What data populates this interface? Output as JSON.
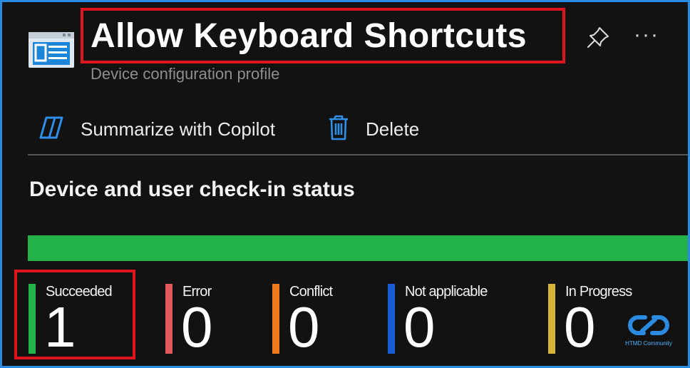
{
  "header": {
    "title": "Allow Keyboard Shortcuts",
    "subtitle": "Device configuration profile",
    "app_icon": "profile-window-icon",
    "pin_icon": "pin-icon",
    "more_icon": "more-ellipsis-icon",
    "more_label": "···"
  },
  "toolbar": {
    "copilot_label": "Summarize with Copilot",
    "copilot_icon": "copilot-icon",
    "delete_label": "Delete",
    "delete_icon": "trash-icon"
  },
  "section": {
    "title": "Device and user check-in status"
  },
  "status": {
    "succeeded_fraction": 1.0,
    "items": [
      {
        "label": "Succeeded",
        "value": "1",
        "color": "#23b24a"
      },
      {
        "label": "Error",
        "value": "0",
        "color": "#e25a5a"
      },
      {
        "label": "Conflict",
        "value": "0",
        "color": "#f07a1e"
      },
      {
        "label": "Not applicable",
        "value": "0",
        "color": "#1a5cd6"
      },
      {
        "label": "In Progress",
        "value": "0",
        "color": "#d8b43a"
      }
    ]
  },
  "watermark": {
    "text": "HTMD Community",
    "icon": "htmd-logo-icon"
  },
  "colors": {
    "accent": "#2a8be0",
    "highlight": "#e0141e",
    "background": "#121212"
  }
}
